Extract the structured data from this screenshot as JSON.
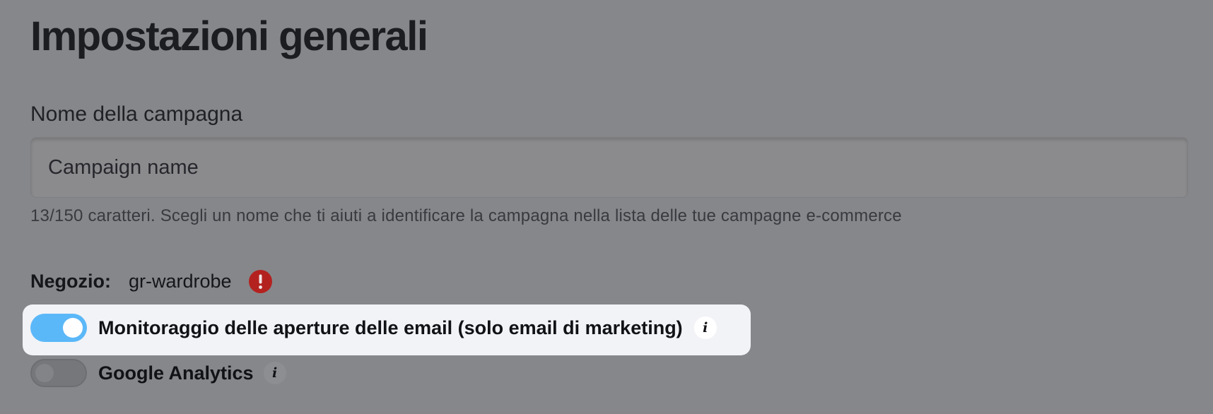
{
  "page": {
    "title": "Impostazioni generali"
  },
  "campaign": {
    "label": "Nome della campagna",
    "value": "Campaign name",
    "helper": "13/150 caratteri. Scegli un nome che ti aiuti a identificare la campagna nella lista delle tue campagne e-commerce"
  },
  "store": {
    "label": "Negozio:",
    "value": "gr-wardrobe",
    "status_icon": "error-exclamation-icon",
    "status_color": "#b3221f"
  },
  "toggles": [
    {
      "label": "Monitoraggio delle aperture delle email (solo email di marketing)",
      "enabled": true,
      "info_icon": "i",
      "highlighted": true
    },
    {
      "label": "Google Analytics",
      "enabled": false,
      "info_icon": "i",
      "highlighted": false
    }
  ],
  "colors": {
    "overlay_background": "#86878a",
    "toggle_on": "#5bb8f8",
    "highlight_card": "#f2f3f7"
  }
}
